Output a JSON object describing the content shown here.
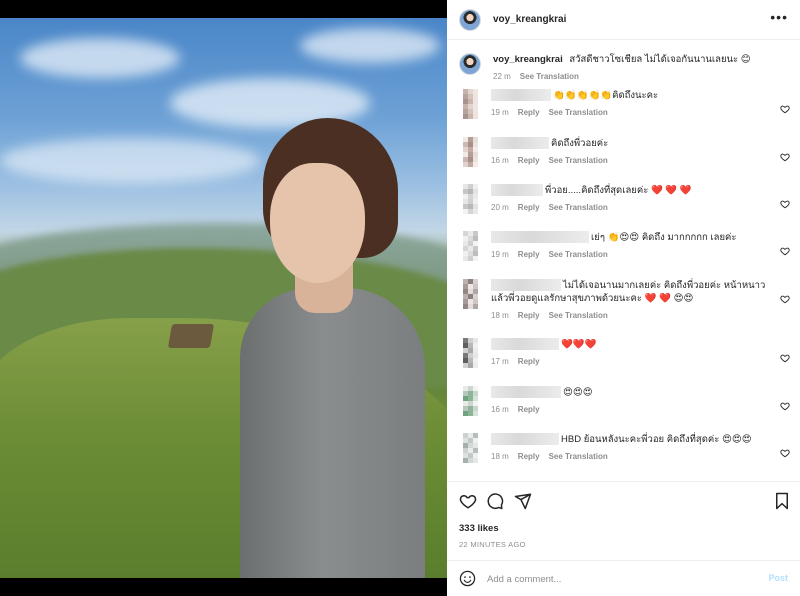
{
  "post": {
    "username": "voy_kreangkrai",
    "more_label": "•••"
  },
  "caption": {
    "username": "voy_kreangkrai",
    "text": "สวัสดีชาวโซเชียล ไม่ได้เจอกันนานเลยนะ 😊",
    "time": "22 m",
    "translate": "See Translation"
  },
  "comments": [
    {
      "text": "👏👏👏👏👏คิดถึงนะคะ",
      "time": "19 m",
      "reply": "Reply",
      "translate": "See Translation",
      "name_width": 60
    },
    {
      "text": "คิดถึงพี่วอยค่ะ",
      "time": "16 m",
      "reply": "Reply",
      "translate": "See Translation",
      "name_width": 58
    },
    {
      "text": "พี่วอย.....คิดถึงที่สุดเลยค่ะ ❤️ ❤️ ❤️",
      "time": "20 m",
      "reply": "Reply",
      "translate": "See Translation",
      "name_width": 52
    },
    {
      "text": "เย่ๆ 👏😍😍 คิดถึง มากกกกก เลยค่ะ",
      "time": "19 m",
      "reply": "Reply",
      "translate": "See Translation",
      "name_width": 98
    },
    {
      "text": "ไม่ได้เจอนานมากเลยค่ะ คิดถึงพี่วอยค่ะ หน้าหนาวแล้วพี่วอยดูแลรักษาสุขภาพด้วยนะคะ ❤️ ❤️ 😍😍",
      "time": "18 m",
      "reply": "Reply",
      "translate": "See Translation",
      "name_width": 70
    },
    {
      "text": "❤️❤️❤️",
      "time": "17 m",
      "reply": "Reply",
      "translate": "",
      "name_width": 68
    },
    {
      "text": "😍😍😍",
      "time": "16 m",
      "reply": "Reply",
      "translate": "",
      "name_width": 70
    },
    {
      "text": "HBD ย้อนหลังนะคะพี่วอย คิดถึงที่สุดค่ะ 😍😍😍",
      "time": "18 m",
      "reply": "Reply",
      "translate": "See Translation",
      "name_width": 68
    }
  ],
  "actions": {
    "likes": "333 likes",
    "time_ago": "22 MINUTES AGO"
  },
  "add_comment": {
    "placeholder": "Add a comment...",
    "post_label": "Post"
  },
  "colors": {
    "link_blue": "#b2dffc",
    "muted": "#8e8e8e",
    "text": "#262626"
  }
}
